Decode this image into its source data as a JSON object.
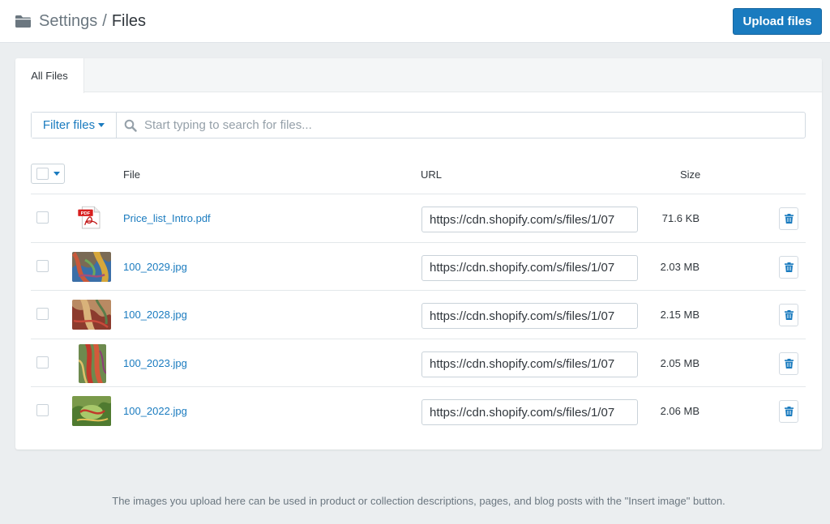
{
  "header": {
    "breadcrumb_parent": "Settings",
    "breadcrumb_sep": "/",
    "breadcrumb_current": "Files",
    "upload_label": "Upload files"
  },
  "tabs": [
    {
      "label": "All Files"
    }
  ],
  "filter": {
    "button_label": "Filter files",
    "search_placeholder": "Start typing to search for files..."
  },
  "table": {
    "columns": {
      "file": "File",
      "url": "URL",
      "size": "Size"
    },
    "rows": [
      {
        "name": "Price_list_Intro.pdf",
        "url": "https://cdn.shopify.com/s/files/1/07",
        "size": "71.6 KB",
        "thumb": "pdf-icon"
      },
      {
        "name": "100_2029.jpg",
        "url": "https://cdn.shopify.com/s/files/1/07",
        "size": "2.03 MB",
        "thumb": "image-thumbnail"
      },
      {
        "name": "100_2028.jpg",
        "url": "https://cdn.shopify.com/s/files/1/07",
        "size": "2.15 MB",
        "thumb": "image-thumbnail"
      },
      {
        "name": "100_2023.jpg",
        "url": "https://cdn.shopify.com/s/files/1/07",
        "size": "2.05 MB",
        "thumb": "image-thumbnail"
      },
      {
        "name": "100_2022.jpg",
        "url": "https://cdn.shopify.com/s/files/1/07",
        "size": "2.06 MB",
        "thumb": "image-thumbnail"
      }
    ]
  },
  "footer": {
    "note": "The images you upload here can be used in product or collection descriptions, pages, and blog posts with the \"Insert image\" button."
  },
  "colors": {
    "accent": "#1a7bbf",
    "background": "#ebeef0"
  }
}
